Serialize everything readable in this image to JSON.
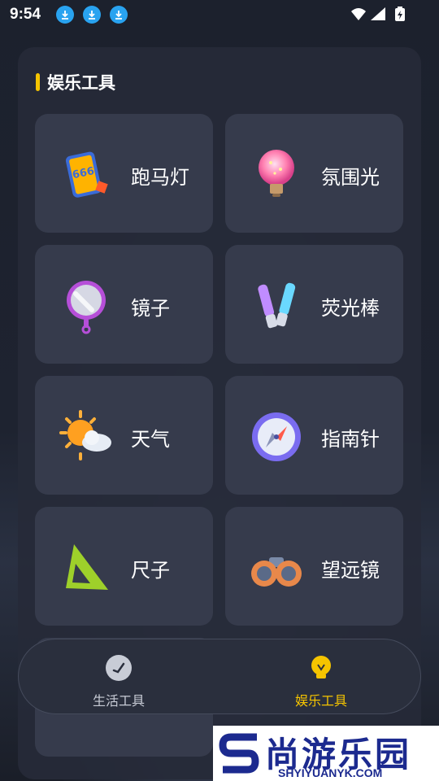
{
  "status_bar": {
    "time": "9:54"
  },
  "section": {
    "title": "娱乐工具"
  },
  "tools": [
    {
      "label": "跑马灯",
      "icon": "marquee-phone-icon"
    },
    {
      "label": "氛围光",
      "icon": "lightbulb-icon"
    },
    {
      "label": "镜子",
      "icon": "hand-mirror-icon"
    },
    {
      "label": "荧光棒",
      "icon": "glow-stick-icon"
    },
    {
      "label": "天气",
      "icon": "sun-cloud-icon"
    },
    {
      "label": "指南针",
      "icon": "compass-icon"
    },
    {
      "label": "尺子",
      "icon": "triangle-ruler-icon"
    },
    {
      "label": "望远镜",
      "icon": "binoculars-icon"
    }
  ],
  "bottom_nav": {
    "items": [
      {
        "label": "生活工具",
        "icon": "clock-icon",
        "active": false
      },
      {
        "label": "娱乐工具",
        "icon": "lightbulb-nav-icon",
        "active": true
      }
    ]
  },
  "watermark": {
    "title": "尚游乐园",
    "url": "SHYIYUANYK.COM"
  },
  "colors": {
    "accent": "#f5c400",
    "card": "#363b4c",
    "panel": "#262a38"
  }
}
